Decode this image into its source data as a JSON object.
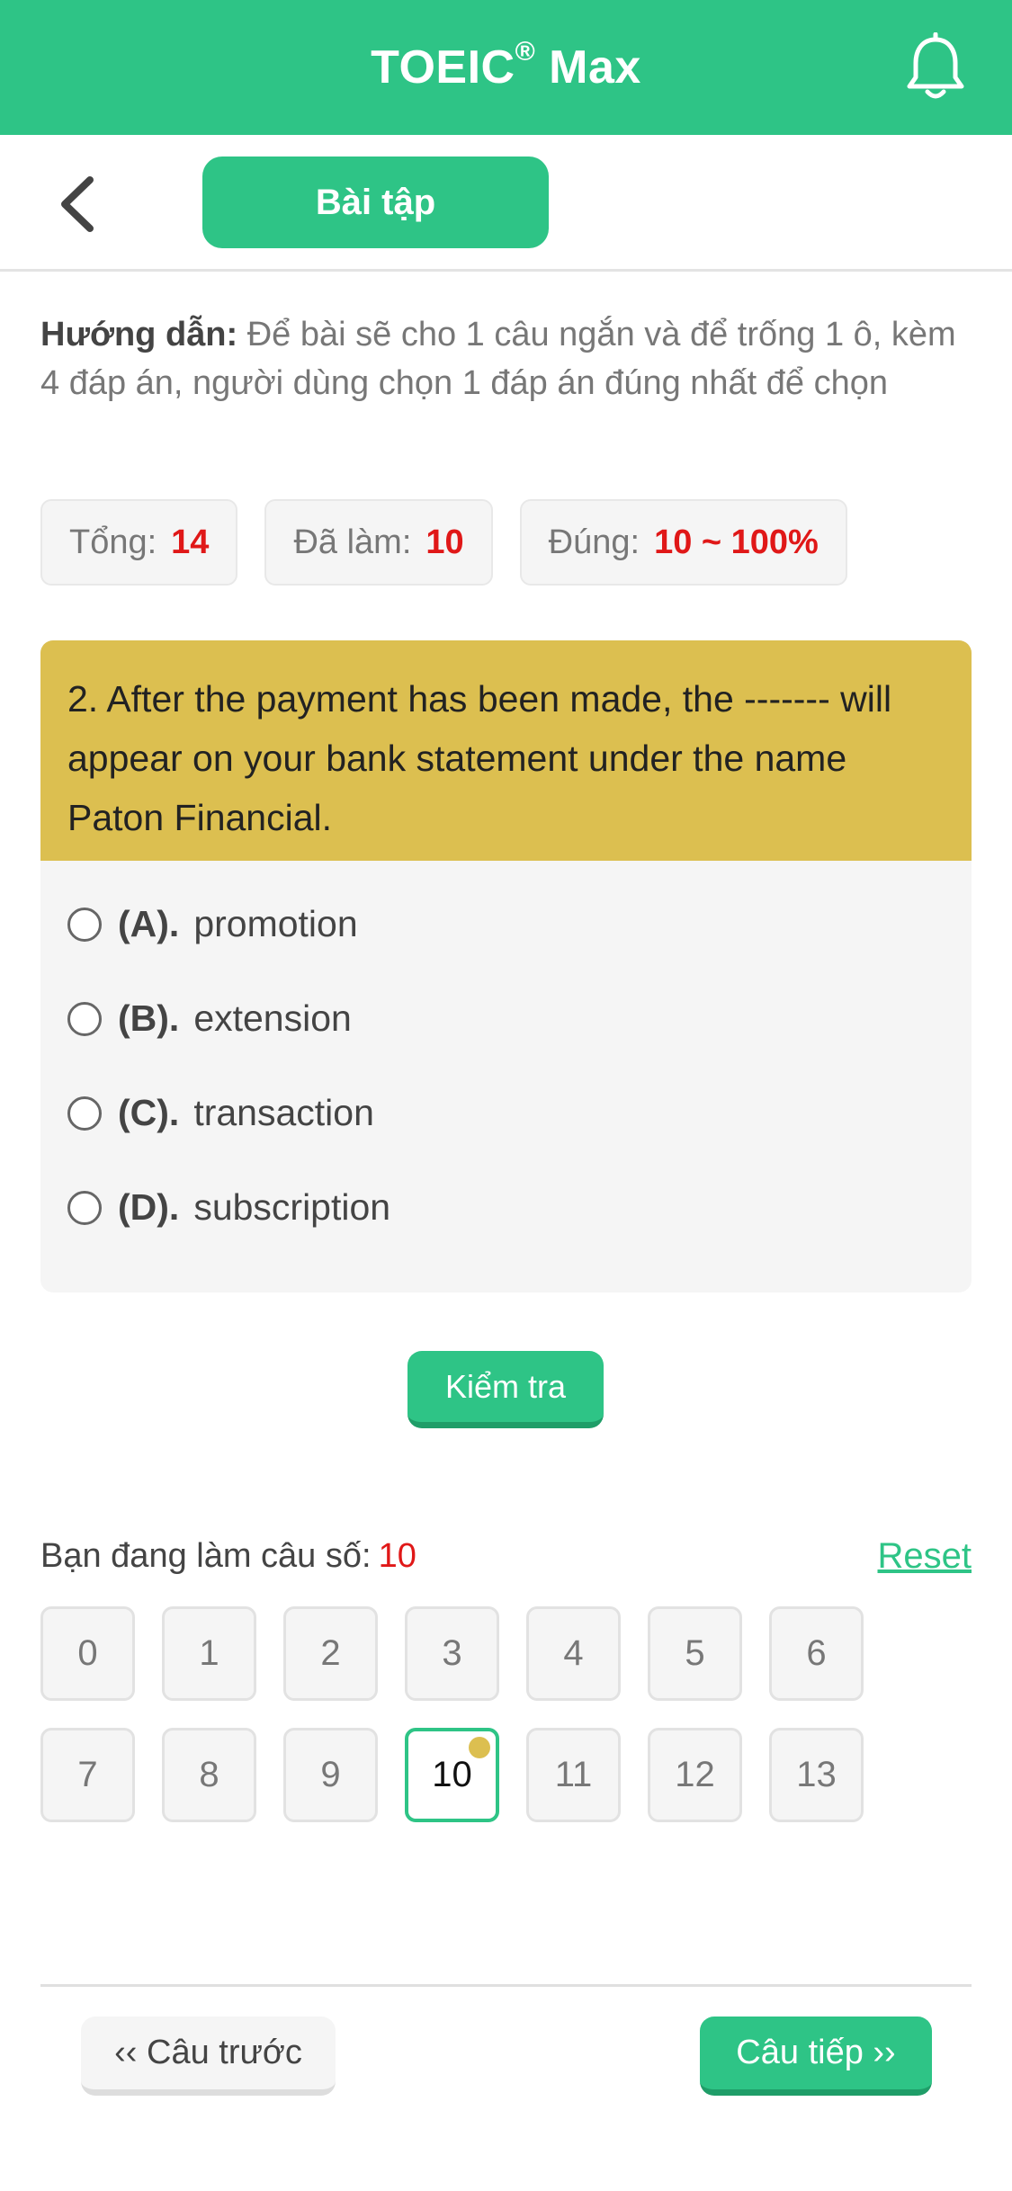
{
  "theme": {
    "accent": "#2ec486",
    "highlight": "#dcbf50",
    "value_red": "#e01818"
  },
  "header": {
    "title": "TOEIC",
    "title_mark": "®",
    "title_suffix": " Max",
    "bell_icon": "bell-icon"
  },
  "subheader": {
    "back_icon": "chevron-left-icon",
    "tab_label": "Bài tập"
  },
  "instructions": {
    "label": "Hướng dẫn:",
    "text": " Để bài sẽ cho 1 câu ngắn và để trống 1 ô, kèm 4 đáp án, người dùng chọn 1 đáp án đúng nhất để chọn"
  },
  "stats": {
    "total_label": "Tổng:",
    "total_value": "14",
    "done_label": "Đã làm:",
    "done_value": "10",
    "correct_label": "Đúng:",
    "correct_value": "10 ~ 100%"
  },
  "question": {
    "text": "2. After the payment has been made, the ------- will appear on your bank statement under the name Paton Financial.",
    "options": [
      {
        "letter": "(A).",
        "text": "promotion"
      },
      {
        "letter": "(B).",
        "text": "extension"
      },
      {
        "letter": "(C).",
        "text": "transaction"
      },
      {
        "letter": "(D).",
        "text": "subscription"
      }
    ]
  },
  "check_button": "Kiểm tra",
  "progress": {
    "label": "Bạn đang làm câu số:",
    "current": "10",
    "reset": "Reset"
  },
  "grid": [
    "0",
    "1",
    "2",
    "3",
    "4",
    "5",
    "6",
    "7",
    "8",
    "9",
    "10",
    "11",
    "12",
    "13"
  ],
  "grid_active": "10",
  "nav": {
    "prev": "‹‹ Câu trước",
    "next": "Câu tiếp ››"
  }
}
